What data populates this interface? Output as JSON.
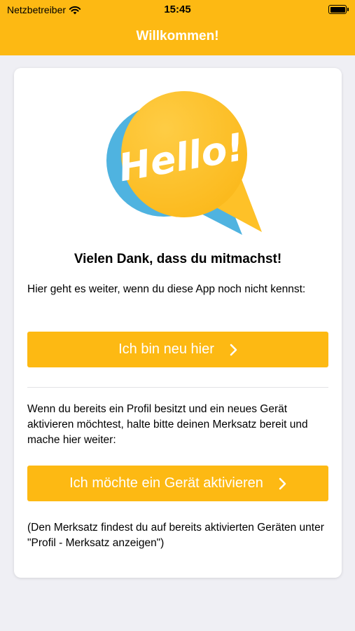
{
  "status_bar": {
    "carrier": "Netzbetreiber",
    "time": "15:45",
    "wifi_icon": "wifi-icon",
    "battery_icon": "battery-icon"
  },
  "nav": {
    "title": "Willkommen!"
  },
  "card": {
    "image": {
      "icon": "hello-speech-bubble",
      "text": "Hello!"
    },
    "headline": "Vielen Dank, dass du mitmachst!",
    "intro_text": "Hier geht es weiter, wenn du diese App noch nicht kennst:",
    "new_button": {
      "label": "Ich bin neu hier",
      "icon": "chevron-right-icon"
    },
    "existing_text": "Wenn du bereits ein Profil besitzt und ein neues Gerät aktivieren möchtest, halte bitte deinen Merksatz bereit und mache hier weiter:",
    "activate_button": {
      "label": "Ich möchte ein Gerät aktivieren",
      "icon": "chevron-right-icon"
    },
    "hint_text": "(Den Merksatz findest du auf bereits aktivierten Geräten unter \"Profil - Merksatz anzeigen\")"
  },
  "colors": {
    "accent": "#fdb913",
    "background": "#efeff4",
    "bubble_shadow": "#4fb3e0"
  }
}
